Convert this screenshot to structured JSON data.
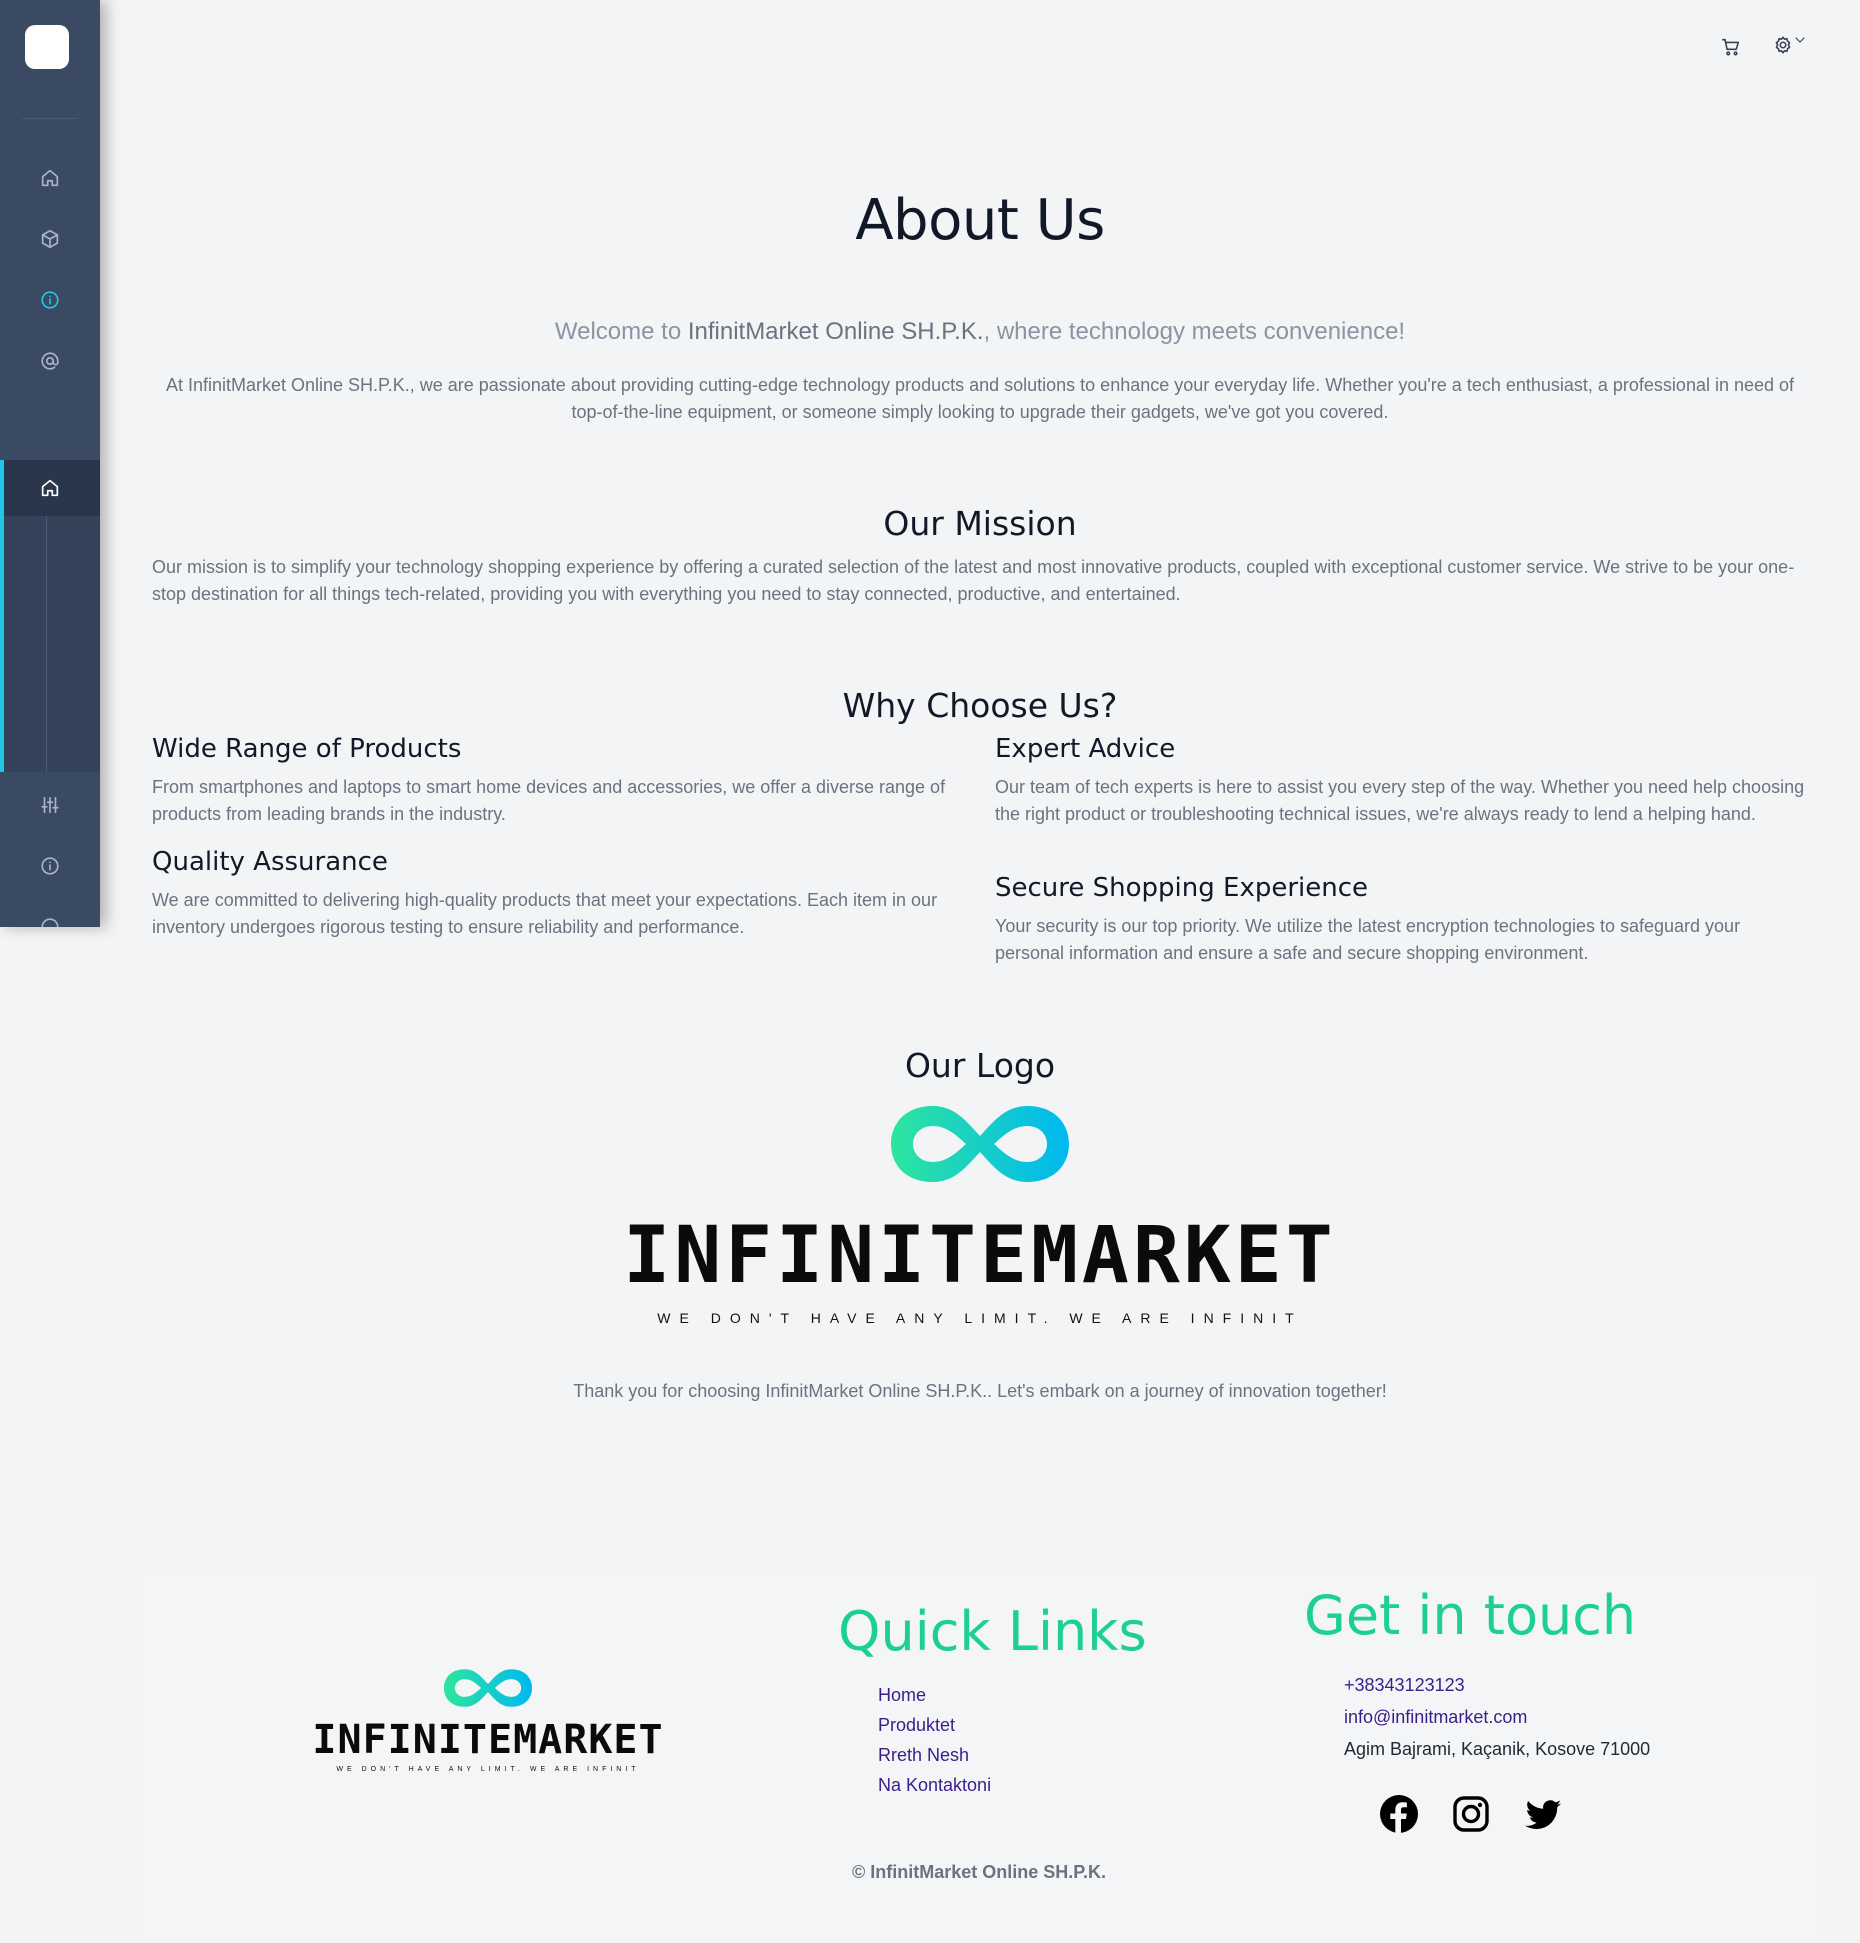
{
  "sidebar": {
    "icons": [
      "home-icon",
      "box-icon",
      "info-icon",
      "at-icon"
    ],
    "sub_icons": [
      "home-icon",
      "sliders-icon",
      "info-icon"
    ],
    "active_color": "#22c5e8"
  },
  "topbar": {
    "icons": [
      "cart-icon",
      "gear-icon",
      "chevron-down-icon"
    ]
  },
  "about": {
    "title": "About Us",
    "welcome_prefix": "Welcome to ",
    "welcome_company": "InfinitMarket Online SH.P.K.",
    "welcome_suffix": ", where technology meets convenience!",
    "intro": "At InfinitMarket Online SH.P.K., we are passionate about providing cutting-edge technology products and solutions to enhance your everyday life. Whether you're a tech enthusiast, a professional in need of top-of-the-line equipment, or someone simply looking to upgrade their gadgets, we've got you covered."
  },
  "mission": {
    "title": "Our Mission",
    "text": "Our mission is to simplify your technology shopping experience by offering a curated selection of the latest and most innovative products, coupled with exceptional customer service. We strive to be your one-stop destination for all things tech-related, providing you with everything you need to stay connected, productive, and entertained."
  },
  "why": {
    "title": "Why Choose Us?",
    "features": [
      {
        "title": "Wide Range of Products",
        "text": "From smartphones and laptops to smart home devices and accessories, we offer a diverse range of products from leading brands in the industry."
      },
      {
        "title": "Expert Advice",
        "text": "Our team of tech experts is here to assist you every step of the way. Whether you need help choosing the right product or troubleshooting technical issues, we're always ready to lend a helping hand."
      },
      {
        "title": "Quality Assurance",
        "text": "We are committed to delivering high-quality products that meet your expectations. Each item in our inventory undergoes rigorous testing to ensure reliability and performance."
      },
      {
        "title": "Secure Shopping Experience",
        "text": "Your security is our top priority. We utilize the latest encryption technologies to safeguard your personal information and ensure a safe and secure shopping environment."
      }
    ]
  },
  "logo": {
    "title": "Our Logo",
    "wordmark": "INFINITEMARKET",
    "tagline": "WE DON'T HAVE ANY LIMIT. WE ARE INFINIT",
    "gradient_start": "#2ee59d",
    "gradient_end": "#00b8f0"
  },
  "thanks": "Thank you for choosing InfinitMarket Online SH.P.K.. Let's embark on a journey of innovation together!",
  "footer": {
    "quick_links_title": "Quick Links",
    "links": [
      "Home",
      "Produktet",
      "Rreth Nesh",
      "Na Kontaktoni"
    ],
    "contact_title": "Get in touch",
    "phone": "+38343123123",
    "email": "info@infinitmarket.com",
    "address": "Agim Bajrami, Kaçanik, Kosove 71000",
    "social": [
      "facebook-icon",
      "instagram-icon",
      "twitter-icon"
    ],
    "copyright": "© InfinitMarket Online SH.P.K.",
    "accent_color": "#1ccf93",
    "link_color": "#3b1d8a"
  }
}
